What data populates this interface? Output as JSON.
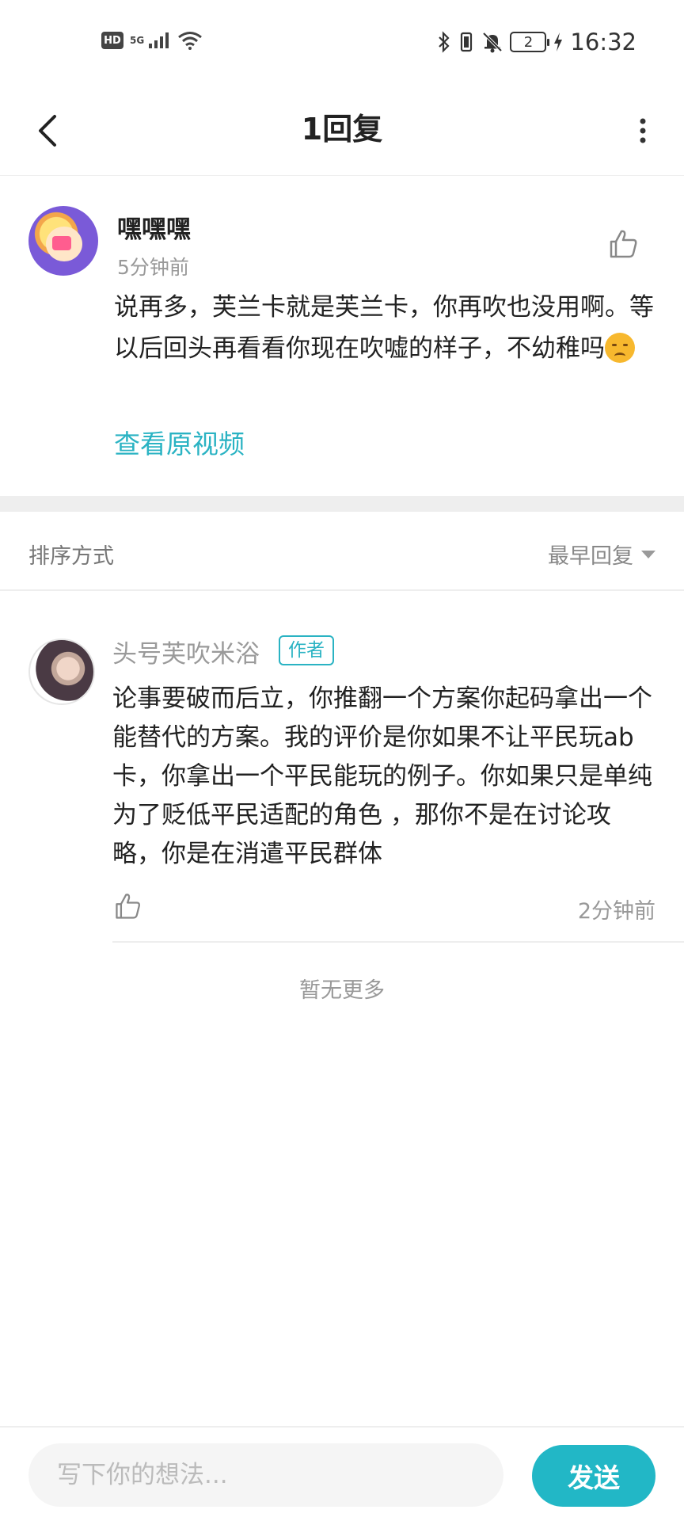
{
  "status_bar": {
    "hd": "HD",
    "network": "5G",
    "battery_level": "2",
    "time": "16:32"
  },
  "header": {
    "title": "1回复"
  },
  "main_comment": {
    "username": "嘿嘿嘿",
    "time": "5分钟前",
    "text": "说再多，芙兰卡就是芙兰卡，你再吹也没用啊。等以后回头再看看你现在吹嘘的样子，不幼稚吗",
    "emoji": "disappointed-face-emoji",
    "view_video_link": "查看原视频"
  },
  "sort": {
    "label": "排序方式",
    "selected": "最早回复"
  },
  "replies": [
    {
      "username": "头号芙吹米浴",
      "badge": "作者",
      "text": "论事要破而后立，你推翻一个方案你起码拿出一个能替代的方案。我的评价是你如果不让平民玩ab卡，你拿出一个平民能玩的例子。你如果只是单纯为了贬低平民适配的角色 ，那你不是在讨论攻略，你是在消遣平民群体",
      "time": "2分钟前"
    }
  ],
  "list_end_text": "暂无更多",
  "composer": {
    "placeholder": "写下你的想法...",
    "value": "",
    "send_label": "发送"
  },
  "colors": {
    "accent": "#22b7c6",
    "link": "#2ab3c3",
    "muted": "#999999"
  }
}
